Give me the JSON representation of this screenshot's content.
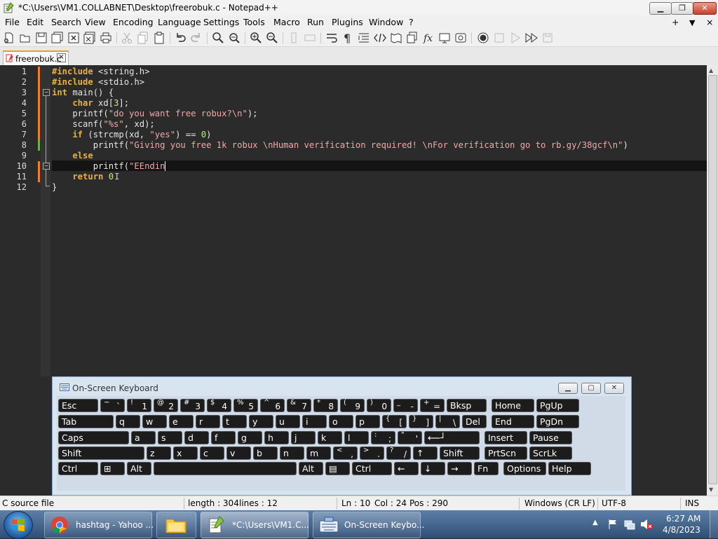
{
  "window": {
    "title": "*C:\\Users\\VM1.COLLABNET\\Desktop\\freerobuk.c - Notepad++"
  },
  "menu": [
    "File",
    "Edit",
    "Search",
    "View",
    "Encoding",
    "Language",
    "Settings",
    "Tools",
    "Macro",
    "Run",
    "Plugins",
    "Window",
    "?"
  ],
  "menu_right": {
    "plus": "+",
    "down": "▼",
    "close": "×"
  },
  "tab": {
    "label": "freerobuk.c",
    "close": "×"
  },
  "editor": {
    "line_numbers": [
      "1",
      "2",
      "3",
      "4",
      "5",
      "6",
      "7",
      "8",
      "9",
      "10",
      "11",
      "12"
    ],
    "lines": {
      "l1a": "#include ",
      "l1b": "<string.h>",
      "l2a": "#include ",
      "l2b": "<stdio.h>",
      "l3a": "int",
      "l3b": " main() {",
      "l4a": "    char",
      "l4b": " xd[",
      "l4c": "3",
      "l4d": "];",
      "l5a": "    printf(",
      "l5b": "\"do you want free robux?\\n\"",
      "l5c": ");",
      "l6a": "    scanf(",
      "l6b": "\"%s\"",
      "l6c": ", xd);",
      "l7a": "    if",
      "l7b": " (strcmp(xd, ",
      "l7c": "\"yes\"",
      "l7d": ") == ",
      "l7e": "0",
      "l7f": ")",
      "l8a": "        printf(",
      "l8b": "\"Giving you free 1k robux \\nHuman verification required! \\nFor verification go to rb.gy/38gcf\\n\"",
      "l8c": ")",
      "l9a": "    else",
      "l10a": "        printf(",
      "l10b": "\"EEndin",
      "l11a": "    return",
      "l11b": " ",
      "l11c": "0",
      "l12a": "}"
    }
  },
  "osk": {
    "title": "On-Screen Keyboard",
    "row1": [
      {
        "p": "Esc"
      },
      {
        "s": "~",
        "b": "`"
      },
      {
        "s": "!",
        "b": "1"
      },
      {
        "s": "@",
        "b": "2"
      },
      {
        "s": "#",
        "b": "3"
      },
      {
        "s": "$",
        "b": "4"
      },
      {
        "s": "%",
        "b": "5"
      },
      {
        "s": "^",
        "b": "6"
      },
      {
        "s": "&",
        "b": "7"
      },
      {
        "s": "*",
        "b": "8"
      },
      {
        "s": "(",
        "b": "9"
      },
      {
        "s": ")",
        "b": "0"
      },
      {
        "s": "_",
        "b": "-"
      },
      {
        "s": "+",
        "b": "="
      },
      {
        "p": "Bksp"
      },
      {
        "p": "Home"
      },
      {
        "p": "PgUp"
      }
    ],
    "row2": [
      {
        "p": "Tab"
      },
      {
        "p": "q"
      },
      {
        "p": "w"
      },
      {
        "p": "e"
      },
      {
        "p": "r"
      },
      {
        "p": "t"
      },
      {
        "p": "y"
      },
      {
        "p": "u"
      },
      {
        "p": "i"
      },
      {
        "p": "o"
      },
      {
        "p": "p"
      },
      {
        "s": "{",
        "b": "["
      },
      {
        "s": "}",
        "b": "]"
      },
      {
        "s": "|",
        "b": "\\"
      },
      {
        "p": "Del"
      },
      {
        "p": "End"
      },
      {
        "p": "PgDn"
      }
    ],
    "row3": [
      {
        "p": "Caps"
      },
      {
        "p": "a"
      },
      {
        "p": "s"
      },
      {
        "p": "d"
      },
      {
        "p": "f"
      },
      {
        "p": "g"
      },
      {
        "p": "h"
      },
      {
        "p": "j"
      },
      {
        "p": "k"
      },
      {
        "p": "l"
      },
      {
        "s": ":",
        "b": ";"
      },
      {
        "s": "\"",
        "b": "'"
      },
      {
        "p": "⟵┘"
      },
      {
        "p": "Insert"
      },
      {
        "p": "Pause"
      }
    ],
    "row4": [
      {
        "p": "Shift"
      },
      {
        "p": "z"
      },
      {
        "p": "x"
      },
      {
        "p": "c"
      },
      {
        "p": "v"
      },
      {
        "p": "b"
      },
      {
        "p": "n"
      },
      {
        "p": "m"
      },
      {
        "s": "<",
        "b": ","
      },
      {
        "s": ">",
        "b": "."
      },
      {
        "s": "?",
        "b": "/"
      },
      {
        "p": "↑"
      },
      {
        "p": "Shift"
      },
      {
        "p": "PrtScn"
      },
      {
        "p": "ScrLk"
      }
    ],
    "row5": [
      {
        "p": "Ctrl"
      },
      {
        "p": "⊞"
      },
      {
        "p": "Alt"
      },
      {
        "p": ""
      },
      {
        "p": "Alt"
      },
      {
        "p": "▤"
      },
      {
        "p": "Ctrl"
      },
      {
        "p": "←"
      },
      {
        "p": "↓"
      },
      {
        "p": "→"
      },
      {
        "p": "Fn"
      },
      {
        "p": "Options"
      },
      {
        "p": "Help"
      }
    ]
  },
  "status": {
    "filetype": "C source file",
    "length": "length : 304",
    "lines": "lines : 12",
    "ln": "Ln : 10",
    "col": "Col : 24",
    "pos": "Pos : 290",
    "eol": "Windows (CR LF)",
    "encoding": "UTF-8",
    "mode": "INS"
  },
  "taskbar": {
    "chrome": "hashtag - Yahoo ...",
    "npp": "*C:\\Users\\VM1.C...",
    "osk": "On-Screen Keybo...",
    "time": "6:27 AM",
    "date": "4/8/2023"
  },
  "colors": {
    "keyword": "#e8b040",
    "string": "#f2a8a8",
    "number": "#c3e88d",
    "editor_bg": "#2b2b2b"
  }
}
